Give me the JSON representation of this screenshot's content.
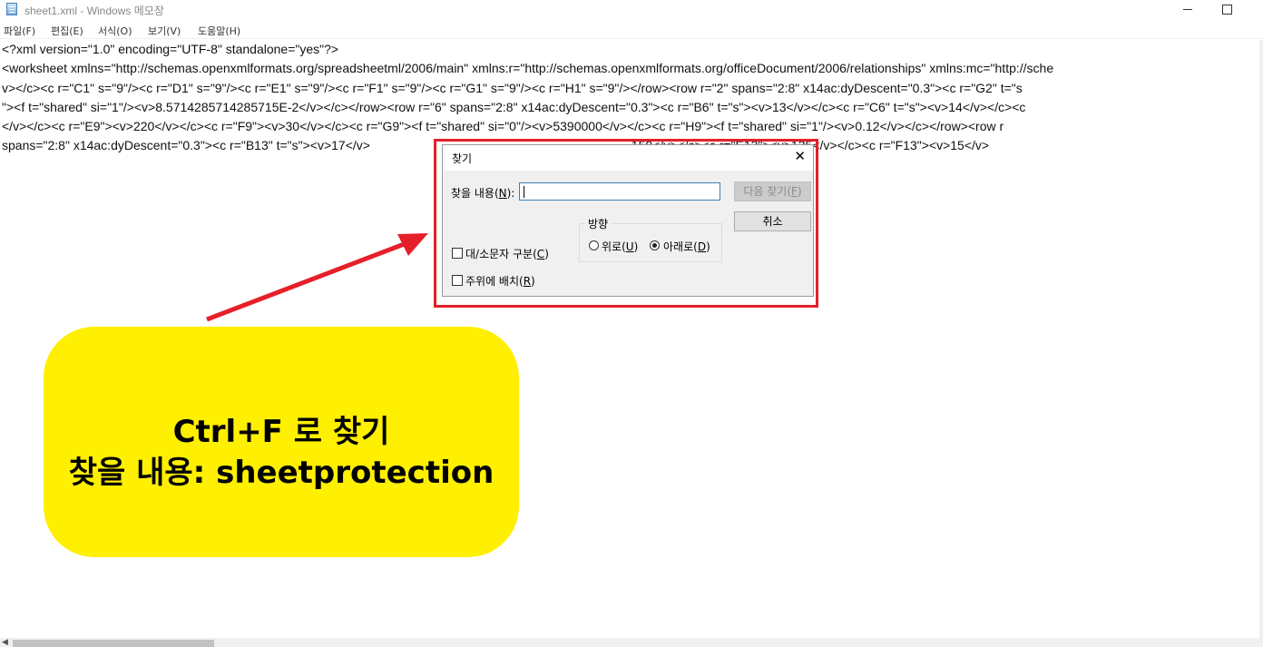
{
  "window": {
    "title": "sheet1.xml - Windows 메모장"
  },
  "menu": [
    {
      "label": "파일(F)"
    },
    {
      "label": "편집(E)"
    },
    {
      "label": "서식(O)"
    },
    {
      "label": "보기(V)"
    },
    {
      "label": "도움말(H)"
    }
  ],
  "editor": {
    "lines": [
      "<?xml version=\"1.0\" encoding=\"UTF-8\" standalone=\"yes\"?>",
      "<worksheet xmlns=\"http://schemas.openxmlformats.org/spreadsheetml/2006/main\" xmlns:r=\"http://schemas.openxmlformats.org/officeDocument/2006/relationships\" xmlns:mc=\"http://sche",
      "v></c><c r=\"C1\" s=\"9\"/><c r=\"D1\" s=\"9\"/><c r=\"E1\" s=\"9\"/><c r=\"F1\" s=\"9\"/><c r=\"G1\" s=\"9\"/><c r=\"H1\" s=\"9\"/></row><row r=\"2\" spans=\"2:8\" x14ac:dyDescent=\"0.3\"><c r=\"G2\" t=\"s",
      "\"><f t=\"shared\" si=\"1\"/><v>8.5714285714285715E-2</v></c></row><row r=\"6\" spans=\"2:8\" x14ac:dyDescent=\"0.3\"><c r=\"B6\" t=\"s\"><v>13</v></c><c r=\"C6\" t=\"s\"><v>14</v></c><c",
      "</v></c><c r=\"E9\"><v>220</v></c><c r=\"F9\"><v>30</v></c><c r=\"G9\"><f t=\"shared\" si=\"0\"/><v>5390000</v></c><c r=\"H9\"><f t=\"shared\" si=\"1\"/><v>0.12</v></c></row><row r",
      "spans=\"2:8\" x14ac:dyDescent=\"0.3\"><c r=\"B13\" t=\"s\"><v>17</v>                                                                          150</v></c><c r=\"E13\"><v>135</v></c><c r=\"F13\"><v>15</v>"
    ]
  },
  "find_dialog": {
    "title": "찾기",
    "find_label": "찾을 내용",
    "find_label_key": "N",
    "find_value": "",
    "find_next_button": "다음 찾기",
    "find_next_key": "F",
    "cancel_button": "취소",
    "direction_label": "방향",
    "up_label": "위로",
    "up_key": "U",
    "down_label": "아래로",
    "down_key": "D",
    "direction_selected": "down",
    "match_case_label": "대/소문자 구분",
    "match_case_key": "C",
    "match_case_checked": false,
    "wrap_label": "주위에 배치",
    "wrap_key": "R",
    "wrap_checked": false
  },
  "annotation": {
    "line1": "Ctrl+F 로 찾기",
    "line2": "찾을 내용: sheetprotection",
    "callout_color": "#ffef00",
    "highlight_color": "#e5202a"
  }
}
